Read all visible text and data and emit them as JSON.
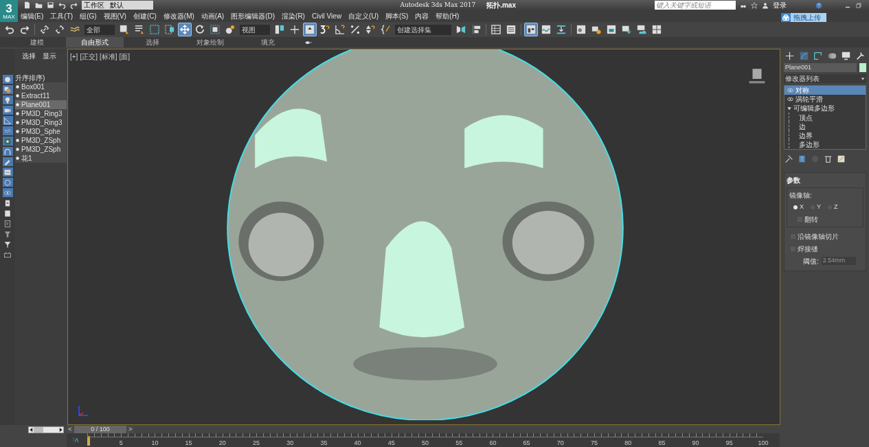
{
  "app": {
    "logo_number": "3",
    "logo_text": "MAX",
    "workspace_label": "工作区",
    "workspace_value": "默认",
    "title": "Autodesk 3ds Max 2017",
    "file": "拓扑.max",
    "search_placeholder": "键入关键字或短语",
    "login": "登录",
    "upload_button": "拖拽上传"
  },
  "menu": [
    "编辑(E)",
    "工具(T)",
    "组(G)",
    "视图(V)",
    "创建(C)",
    "修改器(M)",
    "动画(A)",
    "图形编辑器(D)",
    "渲染(R)",
    "Civil View",
    "自定义(U)",
    "脚本(S)",
    "内容",
    "帮助(H)"
  ],
  "toolbar": [
    {
      "kind": "icon",
      "selected": false
    },
    {
      "kind": "icon",
      "selected": false
    },
    {
      "kind": "sep"
    },
    {
      "kind": "icon",
      "selected": false
    },
    {
      "kind": "icon",
      "selected": false
    },
    {
      "kind": "icon",
      "selected": false
    },
    {
      "kind": "dropdown",
      "value": "全部"
    },
    {
      "kind": "icon",
      "selected": false
    },
    {
      "kind": "icon",
      "selected": false
    },
    {
      "kind": "icon",
      "selected": false
    },
    {
      "kind": "icon",
      "selected": false
    },
    {
      "kind": "icon",
      "selected": true
    },
    {
      "kind": "icon",
      "selected": false
    },
    {
      "kind": "icon",
      "selected": false
    },
    {
      "kind": "icon",
      "selected": false
    },
    {
      "kind": "dropdown",
      "value": "视图"
    },
    {
      "kind": "icon",
      "selected": false
    },
    {
      "kind": "icon",
      "selected": false
    },
    {
      "kind": "icon",
      "selected": true
    },
    {
      "kind": "icon",
      "selected": false
    },
    {
      "kind": "icon",
      "selected": false
    },
    {
      "kind": "icon",
      "selected": false
    },
    {
      "kind": "icon",
      "selected": false
    },
    {
      "kind": "icon",
      "selected": false
    },
    {
      "kind": "dropdown",
      "value": "创建选择集"
    },
    {
      "kind": "icon",
      "selected": false
    },
    {
      "kind": "icon",
      "selected": false
    },
    {
      "kind": "sep"
    },
    {
      "kind": "icon",
      "selected": false
    },
    {
      "kind": "icon",
      "selected": false
    },
    {
      "kind": "sep"
    },
    {
      "kind": "icon",
      "selected": true
    },
    {
      "kind": "icon",
      "selected": false
    },
    {
      "kind": "icon",
      "selected": false
    },
    {
      "kind": "sep"
    },
    {
      "kind": "icon",
      "selected": false
    },
    {
      "kind": "icon",
      "selected": false
    },
    {
      "kind": "icon",
      "selected": false
    },
    {
      "kind": "icon",
      "selected": false
    },
    {
      "kind": "icon",
      "selected": false
    },
    {
      "kind": "icon",
      "selected": false
    }
  ],
  "ribbon_tabs": [
    {
      "label": "建模",
      "selected": false
    },
    {
      "label": "自由形式",
      "selected": true
    },
    {
      "label": "选择",
      "selected": false
    },
    {
      "label": "对象绘制",
      "selected": false
    },
    {
      "label": "填充",
      "selected": false
    }
  ],
  "command_strip": [
    {
      "selected": true
    },
    {
      "selected": true
    },
    {
      "selected": true
    },
    {
      "selected": true
    },
    {
      "selected": true
    },
    {
      "selected": true
    },
    {
      "selected": true
    },
    {
      "selected": true
    },
    {
      "selected": true
    },
    {
      "selected": true
    },
    {
      "selected": true
    },
    {
      "selected": true
    },
    {
      "selected": false
    },
    {
      "selected": false
    },
    {
      "selected": false
    },
    {
      "selected": false
    },
    {
      "selected": false
    },
    {
      "selected": false
    }
  ],
  "scene_explorer": {
    "tabs": [
      "选择",
      "显示"
    ],
    "header": "升序排序)",
    "items": [
      {
        "name": "Box001",
        "selected": false
      },
      {
        "name": "Extract11",
        "selected": false
      },
      {
        "name": "Plane001",
        "selected": true
      },
      {
        "name": "PM3D_Ring3",
        "selected": false
      },
      {
        "name": "PM3D_Ring3",
        "selected": false
      },
      {
        "name": "PM3D_Sphe",
        "selected": false
      },
      {
        "name": "PM3D_ZSph",
        "selected": false
      },
      {
        "name": "PM3D_ZSph",
        "selected": false
      },
      {
        "name": "花1",
        "selected": false
      }
    ]
  },
  "viewport": {
    "labels": [
      "[+]",
      "[正交]",
      "[标准]",
      "[面]"
    ]
  },
  "command_panel": {
    "object_name": "Plane001",
    "modifier_list": "修改器列表",
    "stack": [
      {
        "name": "对称",
        "selected": true
      },
      {
        "name": "涡轮平滑",
        "selected": false
      },
      {
        "name": "可编辑多边形",
        "selected": false,
        "expanded": true,
        "children": [
          {
            "name": "顶点"
          },
          {
            "name": "边"
          },
          {
            "name": "边界"
          },
          {
            "name": "多边形"
          }
        ]
      }
    ],
    "rollout": {
      "title": "参数",
      "mirror_axis_label": "镜像轴:",
      "axes": [
        {
          "label": "X",
          "selected": true
        },
        {
          "label": "Y",
          "selected": false
        },
        {
          "label": "Z",
          "selected": false
        }
      ],
      "flip": {
        "label": "翻转",
        "checked": false
      },
      "slice": {
        "label": "沿镜像轴切片",
        "checked": false
      },
      "weld": {
        "label": "焊接缝",
        "checked": false
      },
      "threshold_label": "阈值:",
      "threshold_value": "2.54mm"
    }
  },
  "time_slider": {
    "prev": "<",
    "reading": "0 / 100",
    "next": ">"
  },
  "timeline": {
    "labels": [
      "5",
      "10",
      "15",
      "20",
      "25",
      "30",
      "35",
      "40",
      "45",
      "50",
      "55",
      "60",
      "65",
      "70",
      "75",
      "80",
      "85",
      "90",
      "95",
      "100"
    ]
  }
}
